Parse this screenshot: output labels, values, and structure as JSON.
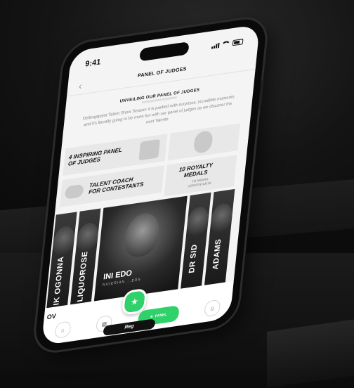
{
  "status": {
    "time": "9:41"
  },
  "nav": {
    "back_icon": "chevron-left-icon",
    "title": "PANEL OF JUDGES"
  },
  "intro": {
    "heading": "UNVEILING OUR PANEL OF JUDGES",
    "description": "Delitrajapaint Talent Show Season 4 is packed with surprises, incredible moments and it's literally going to be more fun with our panel of judges as we discover the next Talents"
  },
  "cards": [
    {
      "title_1": "4 INSPIRING PANEL",
      "title_2": "OF JUDGES",
      "icon": "chair-icon"
    },
    {
      "icon": "medal-icon"
    },
    {
      "title_1": "TALENT COACH",
      "title_2": "FOR CONTESTANTS",
      "icon": "whistle-icon"
    },
    {
      "title_1": "10 ROYALTY",
      "title_2": "MEDALS",
      "sub_1": "TO AWARD",
      "sub_2": "CONTESTANTS"
    }
  ],
  "judges": [
    {
      "name": "IK OGONNA"
    },
    {
      "name": "LIQUOROSE"
    },
    {
      "name": "INI EDO",
      "subtitle": "NIGERIAN ...ERS"
    },
    {
      "name": "DR SID"
    },
    {
      "name": "ADAMS"
    }
  ],
  "tabbar": {
    "overview_label": "OV",
    "tabs": [
      {
        "icon": "home-icon",
        "label": ""
      },
      {
        "icon": "calendar-icon",
        "label": ""
      },
      {
        "icon": "panel-icon",
        "label": "PANEL"
      },
      {
        "icon": "user-icon",
        "label": ""
      }
    ],
    "fab_icon": "star-icon"
  },
  "home_indicator": "Reg",
  "colors": {
    "accent": "#2fd16b",
    "screen_bg": "#f4f4f4",
    "card_bg": "#e8e8e8"
  }
}
